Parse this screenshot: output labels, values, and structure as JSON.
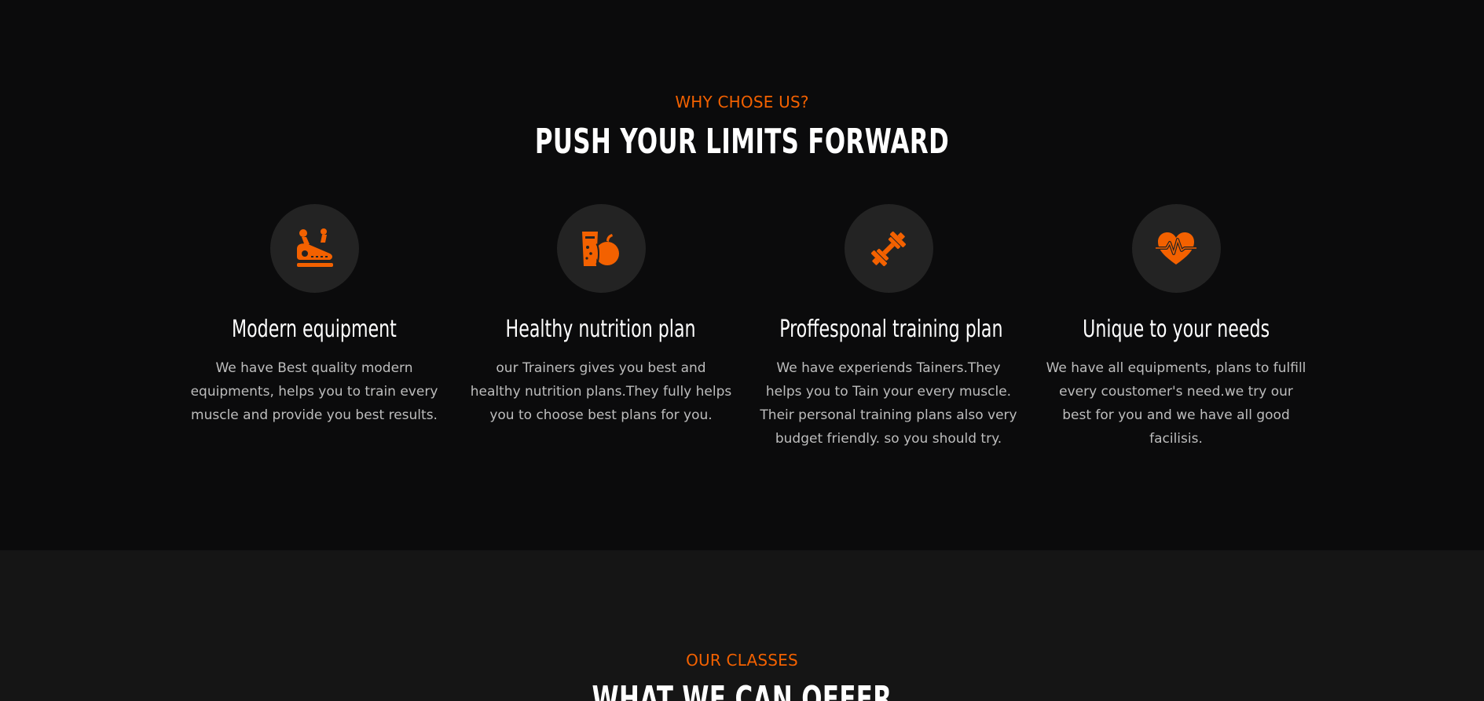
{
  "why_section": {
    "eyebrow": "WHY CHOSE US?",
    "headline": "PUSH YOUR LIMITS FORWARD",
    "features": [
      {
        "icon": "treadmill-icon",
        "title": "Modern equipment",
        "text": "We have Best quality modern equipments, helps you to train every muscle and provide you best results."
      },
      {
        "icon": "nutrition-icon",
        "title": "Healthy nutrition plan",
        "text": "our Trainers gives you best and healthy nutrition plans.They fully helps you to choose best plans for you."
      },
      {
        "icon": "dumbbell-icon",
        "title": "Proffesponal training plan",
        "text": "We have experiends Tainers.They helps you to Tain your every muscle. Their personal training plans also very budget friendly. so you should try."
      },
      {
        "icon": "heart-pulse-icon",
        "title": "Unique to your needs",
        "text": "We have all equipments, plans to fulfill every coustomer's need.we try our best for you and we have all good facilisis."
      }
    ]
  },
  "classes_section": {
    "eyebrow": "OUR CLASSES",
    "headline": "WHAT WE CAN OFFER"
  },
  "colors": {
    "accent": "#f36100",
    "background": "#0b0b0c",
    "background_alt": "#151515",
    "icon_circle": "#232323",
    "heading": "#ffffff",
    "body_text": "#bdbdbd"
  }
}
